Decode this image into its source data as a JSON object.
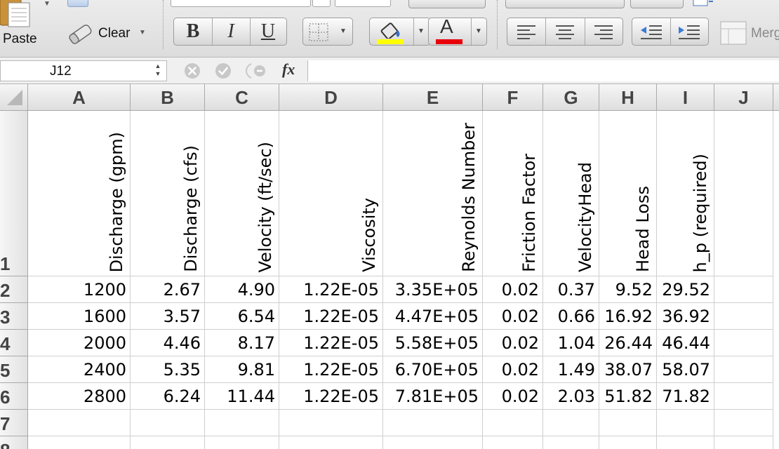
{
  "ribbon": {
    "paste_label": "Paste",
    "clear_label": "Clear",
    "merge_label": "Merg",
    "fill_color": "#ffff00",
    "font_color": "#e8000b",
    "bold_label": "B",
    "italic_label": "I",
    "underline_label": "U",
    "font_color_letter": "A"
  },
  "formula_bar": {
    "name_box": "J12",
    "fx_label": "fx",
    "formula": ""
  },
  "sheet": {
    "columns": [
      "A",
      "B",
      "C",
      "D",
      "E",
      "F",
      "G",
      "H",
      "I",
      "J"
    ],
    "rows": [
      "1",
      "2",
      "3",
      "4",
      "5",
      "6",
      "7",
      "8"
    ],
    "headers": [
      "Discharge (gpm)",
      "Discharge (cfs)",
      "Velocity (ft/sec)",
      "Viscosity",
      "Reynolds Number",
      "Friction Factor",
      "VelocityHead",
      "Head Loss",
      "h_p (required)"
    ],
    "data": [
      [
        "1200",
        "2.67",
        "4.90",
        "1.22E-05",
        "3.35E+05",
        "0.02",
        "0.37",
        "9.52",
        "29.52"
      ],
      [
        "1600",
        "3.57",
        "6.54",
        "1.22E-05",
        "4.47E+05",
        "0.02",
        "0.66",
        "16.92",
        "36.92"
      ],
      [
        "2000",
        "4.46",
        "8.17",
        "1.22E-05",
        "5.58E+05",
        "0.02",
        "1.04",
        "26.44",
        "46.44"
      ],
      [
        "2400",
        "5.35",
        "9.81",
        "1.22E-05",
        "6.70E+05",
        "0.02",
        "1.49",
        "38.07",
        "58.07"
      ],
      [
        "2800",
        "6.24",
        "11.44",
        "1.22E-05",
        "7.81E+05",
        "0.02",
        "2.03",
        "51.82",
        "71.82"
      ]
    ]
  }
}
